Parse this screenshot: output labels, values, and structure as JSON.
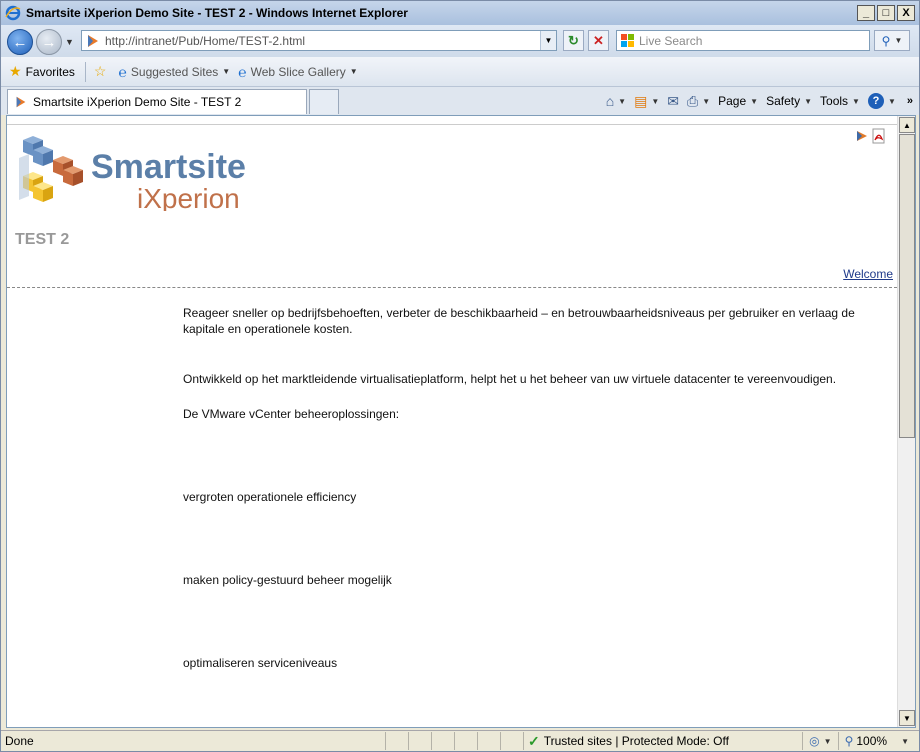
{
  "window": {
    "title": "Smartsite iXperion Demo Site - TEST 2 - Windows Internet Explorer",
    "buttons": {
      "minimize": "_",
      "maximize": "□",
      "close": "X"
    }
  },
  "address": {
    "url": "http://intranet/Pub/Home/TEST-2.html",
    "search_placeholder": "Live Search"
  },
  "favorites_bar": {
    "favorites_label": "Favorites",
    "items": [
      {
        "label": "Suggested Sites"
      },
      {
        "label": "Web Slice Gallery"
      }
    ]
  },
  "tabs": [
    {
      "label": "Smartsite iXperion Demo Site - TEST 2"
    }
  ],
  "command_bar": {
    "page_label": "Page",
    "safety_label": "Safety",
    "tools_label": "Tools",
    "help_glyph": "?"
  },
  "page": {
    "logo": {
      "line1": "Smartsite",
      "line2": "iXperion"
    },
    "title": "TEST 2",
    "welcome_link": "Welcome",
    "paragraphs": [
      "Reageer sneller op bedrijfsbehoeften, verbeter de beschikbaarheid – en betrouwbaarheidsniveaus per gebruiker en verlaag de kapitale en operationele kosten.",
      "Ontwikkeld op het marktleidende virtualisatieplatform, helpt het u het beheer van uw virtuele datacenter te vereenvoudigen.",
      "De VMware vCenter beheeroplossingen:",
      "vergroten operationele efficiency",
      "maken policy-gestuurd beheer mogelijk",
      "optimaliseren serviceniveaus"
    ]
  },
  "status_bar": {
    "status": "Done",
    "zone": "Trusted sites | Protected Mode: Off",
    "zoom": "100%"
  },
  "colors": {
    "logo_blue": "#5b7fa8",
    "logo_orange": "#c0714a",
    "link": "#1f3a8a"
  }
}
